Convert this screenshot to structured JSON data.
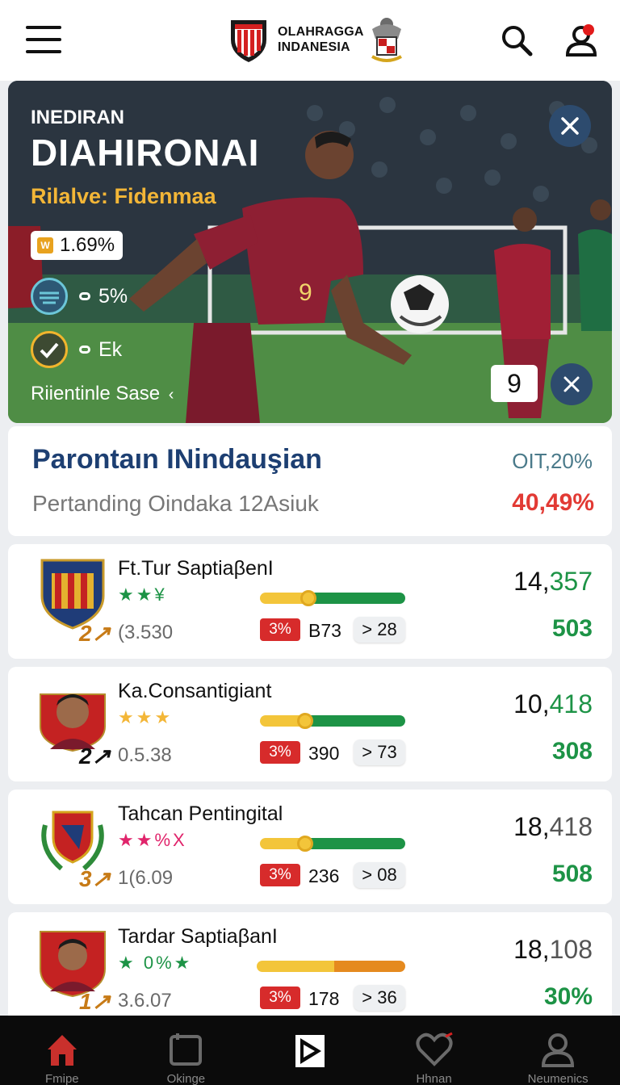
{
  "header": {
    "brand_line1": "OLAHRAGGA",
    "brand_line2": "INDANESIA",
    "menu_icon": "hamburger-icon",
    "search_icon": "search-icon",
    "user_icon": "user-icon",
    "notification_dot_color": "#e21b1b"
  },
  "hero": {
    "overline": "INEDIRAN",
    "title": "DIAHIRONAI",
    "subtitle": "Rilalve: Fidenmaa",
    "stat_icon": "W",
    "stat_value": "1.69%",
    "row1_value": "5%",
    "row2_value": "Ek",
    "link_text": "Riientinle Sase",
    "link_arrow": "‹",
    "counter": "9",
    "jersey_number": "9",
    "player_jersey_color": "#8e1f33"
  },
  "summary": {
    "title": "Parontaın INindauşian",
    "subtitle": "Pertanding Oindaka 12Asiuk",
    "pct_top": "OIT,20%",
    "pct_bottom": "40,49%"
  },
  "teams": [
    {
      "name": "Ft.Tur SaptiaβenI",
      "stars": "★★¥",
      "num": "2↗",
      "sub": "(3.530",
      "red_badge": "3%",
      "mid": "B73",
      "arrow_value": "> 28",
      "total_black": "14,",
      "total_green": "357",
      "small": "503",
      "bar_fill": 0.33
    },
    {
      "name": "Ka.Consantigiant",
      "stars": "★★★",
      "num": "2↗",
      "sub": "0.5.38",
      "red_badge": "3%",
      "mid": "390",
      "arrow_value": "> 73",
      "total_black": "10,",
      "total_green": "418",
      "small": "308",
      "bar_fill": 0.31
    },
    {
      "name": "Tahcan Pentingital",
      "stars": "★★%X",
      "num": "3↗",
      "sub": "1(6.09",
      "red_badge": "3%",
      "mid": "236",
      "arrow_value": "> 08",
      "total_black": "18,",
      "total_green": "418",
      "small": "508",
      "bar_fill": 0.31
    },
    {
      "name": "Tardar SaptiaβanI",
      "stars": "★ 0%★",
      "num": "1↗",
      "sub": "3.6.07",
      "red_badge": "3%",
      "mid": "178",
      "arrow_value": "> 36",
      "total_black": "18,",
      "total_green": "108",
      "small": "30%",
      "bar_fill": 0.5
    }
  ],
  "nav": [
    {
      "label": "Fmipe",
      "icon": "home-icon",
      "active": true
    },
    {
      "label": "Okinge",
      "icon": "square-icon",
      "active": false
    },
    {
      "label": "",
      "icon": "play-logo-icon",
      "active": false
    },
    {
      "label": "Hhnan",
      "icon": "heart-icon",
      "active": false
    },
    {
      "label": "Neumenics",
      "icon": "profile-icon",
      "active": false
    }
  ]
}
